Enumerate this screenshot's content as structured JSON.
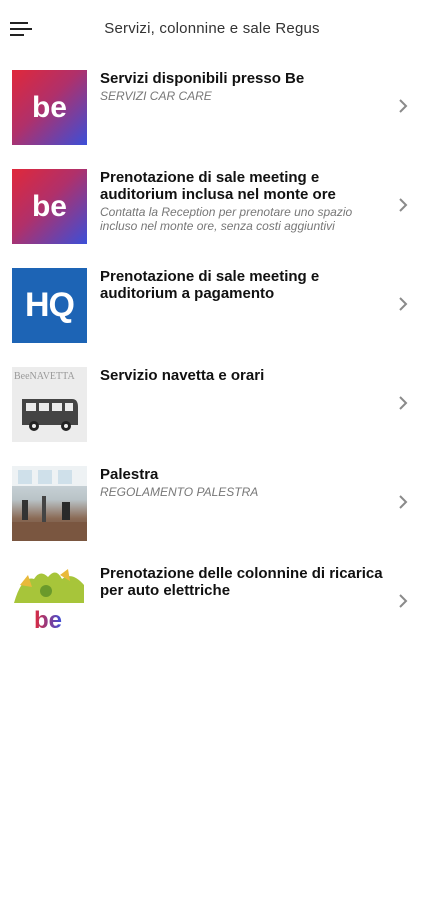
{
  "header": {
    "title": "Servizi, colonnine e sale Regus",
    "menu_icon": "hamburger-menu-icon"
  },
  "items": [
    {
      "title": "Servizi disponibili presso Be",
      "subtitle": "SERVIZI CAR CARE",
      "thumb_text": "be",
      "icon": "be-logo-icon"
    },
    {
      "title": "Prenotazione di sale meeting e auditorium inclusa nel monte ore",
      "subtitle": "Contatta la Reception per prenotare uno spazio incluso nel monte ore, senza costi aggiuntivi",
      "thumb_text": "be",
      "icon": "be-logo-icon"
    },
    {
      "title": "Prenotazione di sale meeting e auditorium a pagamento",
      "subtitle": "",
      "thumb_text": "HQ",
      "icon": "hq-logo-icon"
    },
    {
      "title": "Servizio navetta e orari",
      "subtitle": "",
      "thumb_text": "BeeNAVETTA",
      "icon": "shuttle-bus-icon"
    },
    {
      "title": "Palestra",
      "subtitle": "REGOLAMENTO PALESTRA",
      "thumb_text": "",
      "icon": "gym-photo"
    },
    {
      "title": "Prenotazione delle colonnine di ricarica per auto elettriche",
      "subtitle": "",
      "thumb_text": "be",
      "icon": "ev-charging-logo-icon"
    }
  ],
  "colors": {
    "accent_red": "#e0283a",
    "accent_blue": "#3b4fd8",
    "hq_blue": "#1d64b5",
    "chevron": "#8a8a8a"
  }
}
